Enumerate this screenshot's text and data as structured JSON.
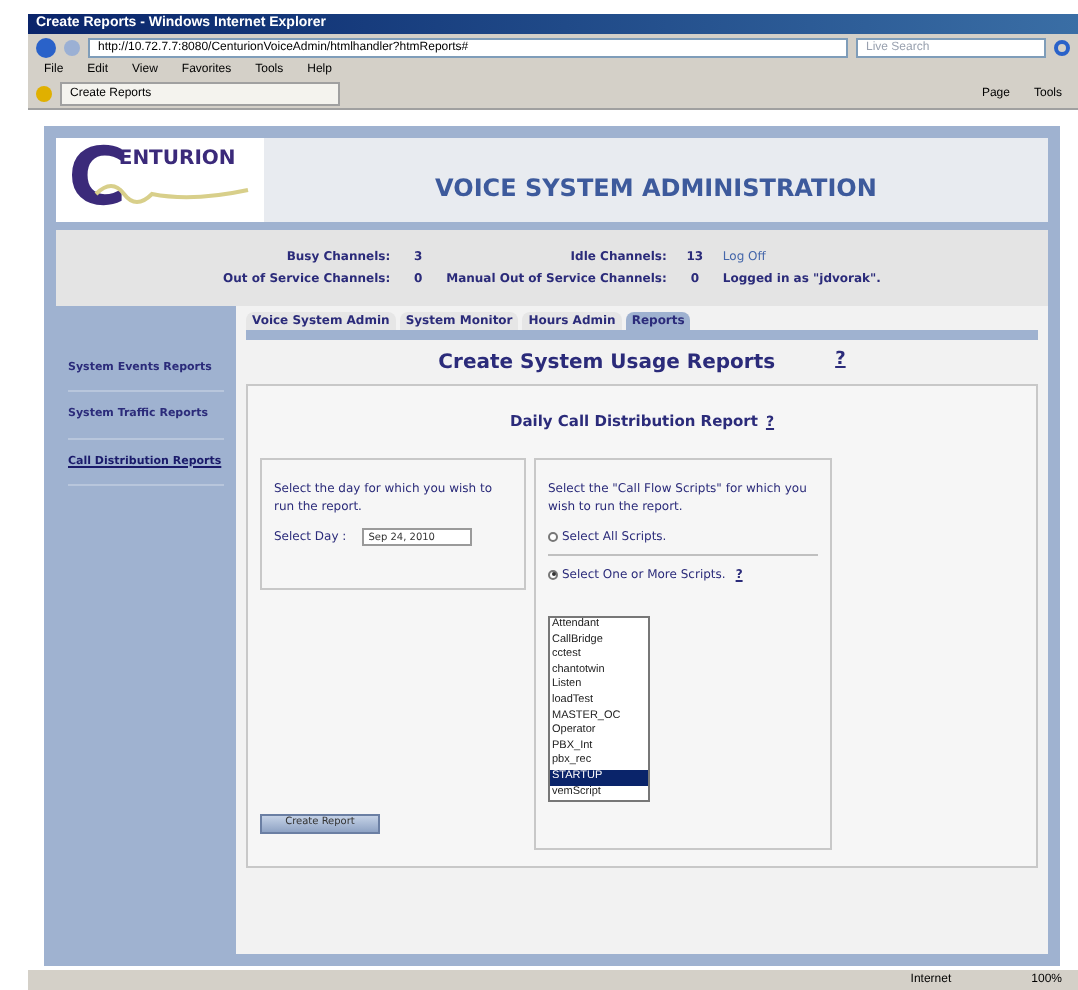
{
  "browser": {
    "title": "Create Reports - Windows Internet Explorer",
    "address": "http://10.72.7.7:8080/CenturionVoiceAdmin/htmlhandler?htmReports#",
    "search_placeholder": "Live Search",
    "menu": [
      "File",
      "Edit",
      "View",
      "Favorites",
      "Tools",
      "Help"
    ],
    "tab": "Create Reports",
    "toolbar": [
      "Page",
      "Tools"
    ],
    "status_zone": "Internet",
    "zoom": "100%"
  },
  "logo": {
    "initial": "C",
    "text": "ENTURION"
  },
  "app_title": "VOICE SYSTEM ADMINISTRATION",
  "stats": [
    {
      "label": "Busy Channels:",
      "value": "3"
    },
    {
      "label": "Idle Channels:",
      "value": "13"
    },
    {
      "label": "Out of Service Channels:",
      "value": "0"
    },
    {
      "label": "Manual Out of Service Channels:",
      "value": "0"
    }
  ],
  "log_off": "Log Off",
  "logged_in": "Logged in as \"jdvorak\".",
  "sidebar": [
    {
      "label": "System Events Reports",
      "selected": false
    },
    {
      "label": "System Traffic Reports",
      "selected": false
    },
    {
      "label": "Call Distribution Reports",
      "selected": true
    }
  ],
  "tabs": [
    {
      "label": "Voice System Admin",
      "selected": false
    },
    {
      "label": "System Monitor",
      "selected": false
    },
    {
      "label": "Hours Admin",
      "selected": false
    },
    {
      "label": "Reports",
      "selected": true
    }
  ],
  "page_title": "Create System Usage Reports",
  "help": "?",
  "report_title": "Daily Call Distribution Report",
  "report_help": "?",
  "day_prompt": "Select the day for which you wish to run the report.",
  "day_label": "Select Day :",
  "day_value": "Sep 24, 2010",
  "scripts_prompt": "Select the \"Call Flow Scripts\" for which you wish to run the report.",
  "radios": [
    {
      "label": "Select All Scripts.",
      "selected": false
    },
    {
      "label": "Select One or More Scripts.",
      "selected": true,
      "help": "?"
    }
  ],
  "scripts": [
    {
      "label": "Attendant",
      "selected": false
    },
    {
      "label": "CallBridge",
      "selected": false
    },
    {
      "label": "cctest",
      "selected": false
    },
    {
      "label": "chantotwin",
      "selected": false
    },
    {
      "label": "Listen",
      "selected": false
    },
    {
      "label": "loadTest",
      "selected": false
    },
    {
      "label": "MASTER_OC",
      "selected": false
    },
    {
      "label": "Operator",
      "selected": false
    },
    {
      "label": "PBX_Int",
      "selected": false
    },
    {
      "label": "pbx_rec",
      "selected": false
    },
    {
      "label": "STARTUP",
      "selected": true
    },
    {
      "label": "vemScript",
      "selected": false
    }
  ],
  "create_button": "Create Report"
}
